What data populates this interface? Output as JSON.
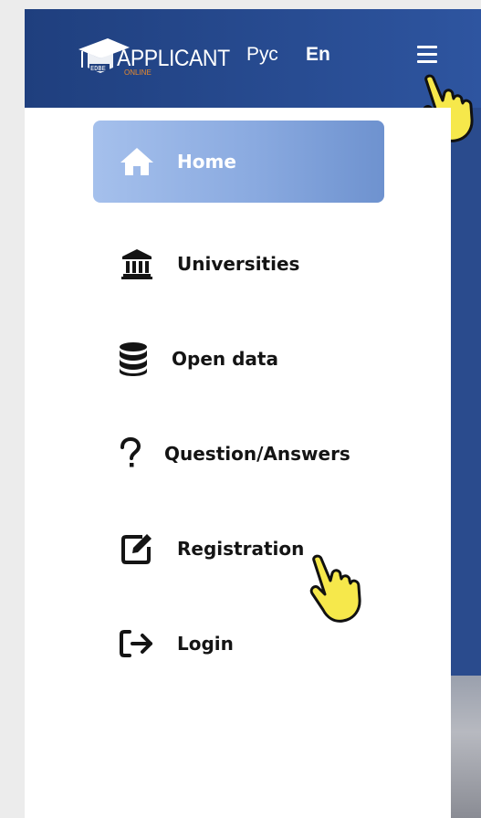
{
  "header": {
    "logo_text": "APPLICANT",
    "logo_subtext": "ONLINE",
    "languages": [
      "Рус",
      "En"
    ],
    "active_language": "En"
  },
  "menu": {
    "items": [
      {
        "label": "Home",
        "icon": "home-icon",
        "active": true
      },
      {
        "label": "Universities",
        "icon": "university-icon",
        "active": false
      },
      {
        "label": "Open data",
        "icon": "database-icon",
        "active": false
      },
      {
        "label": "Question/Answers",
        "icon": "question-icon",
        "active": false
      },
      {
        "label": "Registration",
        "icon": "edit-icon",
        "active": false
      },
      {
        "label": "Login",
        "icon": "login-icon",
        "active": false
      }
    ]
  },
  "colors": {
    "header_bg": "#284c92",
    "active_item_bg": "#8aaae0",
    "hand_pointer": "#f6e84b"
  }
}
